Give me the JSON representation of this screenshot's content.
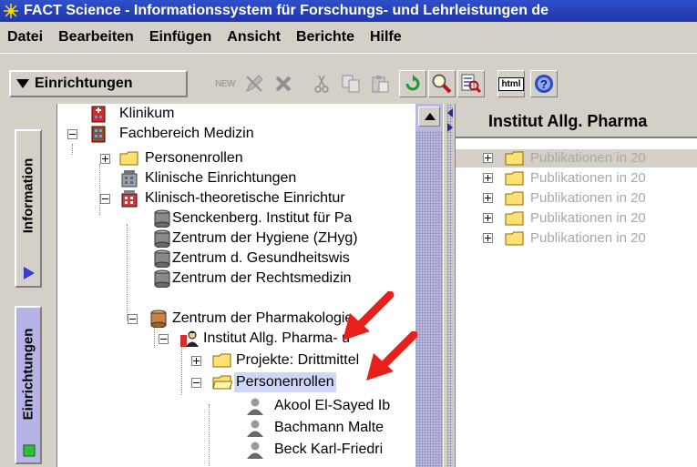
{
  "window": {
    "title": "FACT Science - Informationssystem für Forschungs- und Lehrleistungen de"
  },
  "menu": [
    {
      "label": "Datei"
    },
    {
      "label": "Bearbeiten"
    },
    {
      "label": "Einfügen"
    },
    {
      "label": "Ansicht"
    },
    {
      "label": "Berichte"
    },
    {
      "label": "Hilfe"
    }
  ],
  "toolbar": {
    "dropdown_label": "Einrichtungen",
    "new_label": "NEW",
    "html_label": "html"
  },
  "side_tabs": {
    "information": "Information",
    "einrichtungen": "Einrichtungen"
  },
  "tree": [
    {
      "label": "Klinikum"
    },
    {
      "label": "Fachbereich Medizin"
    },
    {
      "label": "Personenrollen"
    },
    {
      "label": "Klinische Einrichtungen"
    },
    {
      "label": "Klinisch-theoretische Einrichtur"
    },
    {
      "label": "Senckenberg. Institut für Pa"
    },
    {
      "label": "Zentrum der Hygiene (ZHyg)"
    },
    {
      "label": "Zentrum d. Gesundheitswis"
    },
    {
      "label": "Zentrum der Rechtsmedizin"
    },
    {
      "label": "Zentrum der Pharmakologie"
    },
    {
      "label": "Institut Allg. Pharma- u"
    },
    {
      "label": "Projekte: Drittmittel"
    },
    {
      "label": "Personenrollen"
    },
    {
      "label": "Akool El-Sayed Ib"
    },
    {
      "label": "Bachmann Malte"
    },
    {
      "label": "Beck Karl-Friedri"
    }
  ],
  "right": {
    "header": "Institut Allg. Pharma",
    "items": [
      {
        "label": "Publikationen in 20"
      },
      {
        "label": "Publikationen in 20"
      },
      {
        "label": "Publikationen in 20"
      },
      {
        "label": "Publikationen in 20"
      },
      {
        "label": "Publikationen in 20"
      }
    ]
  },
  "colors": {
    "title_bar": "#2f4fcb",
    "chrome": "#d4d0c8",
    "selection": "#cfd6f6",
    "annotation_arrow": "#e8201a",
    "active_tab": "#b7b3e6"
  }
}
